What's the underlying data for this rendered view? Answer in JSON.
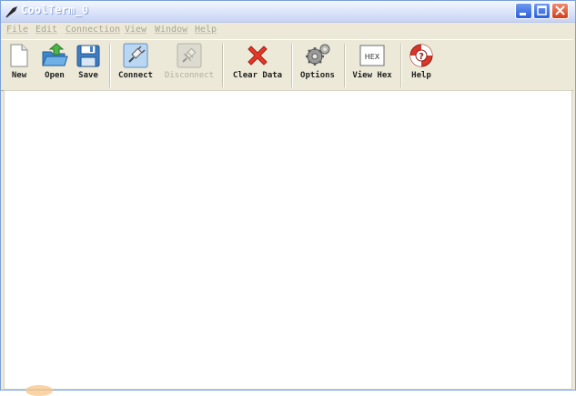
{
  "window": {
    "title": "CoolTerm_0",
    "app_icon": "coolterm-feather-icon",
    "controls": {
      "minimize": "minimize-icon",
      "maximize": "maximize-icon",
      "close": "close-icon"
    }
  },
  "menubar": {
    "items": [
      {
        "label": "File"
      },
      {
        "label": "Edit"
      },
      {
        "label": "Connection"
      },
      {
        "label": "View"
      },
      {
        "label": "Window"
      },
      {
        "label": "Help"
      }
    ]
  },
  "toolbar": {
    "items": [
      {
        "label": "New",
        "icon": "new-document-icon",
        "enabled": true
      },
      {
        "label": "Open",
        "icon": "open-folder-icon",
        "enabled": true
      },
      {
        "label": "Save",
        "icon": "floppy-disk-icon",
        "enabled": true
      },
      {
        "label": "Connect",
        "icon": "connect-plug-icon",
        "enabled": true
      },
      {
        "label": "Disconnect",
        "icon": "disconnect-plug-icon",
        "enabled": false
      },
      {
        "label": "Clear Data",
        "icon": "red-x-icon",
        "enabled": true
      },
      {
        "label": "Options",
        "icon": "gears-icon",
        "enabled": true
      },
      {
        "label": "View Hex",
        "icon": "hex-icon",
        "hex_text": "HEX",
        "enabled": true
      },
      {
        "label": "Help",
        "icon": "lifebuoy-help-icon",
        "enabled": true
      }
    ]
  },
  "colors": {
    "title_gradient_start": "#f4f7ff",
    "title_gradient_end": "#c6d3f2",
    "chrome": "#ece9d8",
    "close_button": "#d23f1d",
    "min_max_button": "#2a5fd8",
    "clear_data_red": "#e23a2a"
  }
}
